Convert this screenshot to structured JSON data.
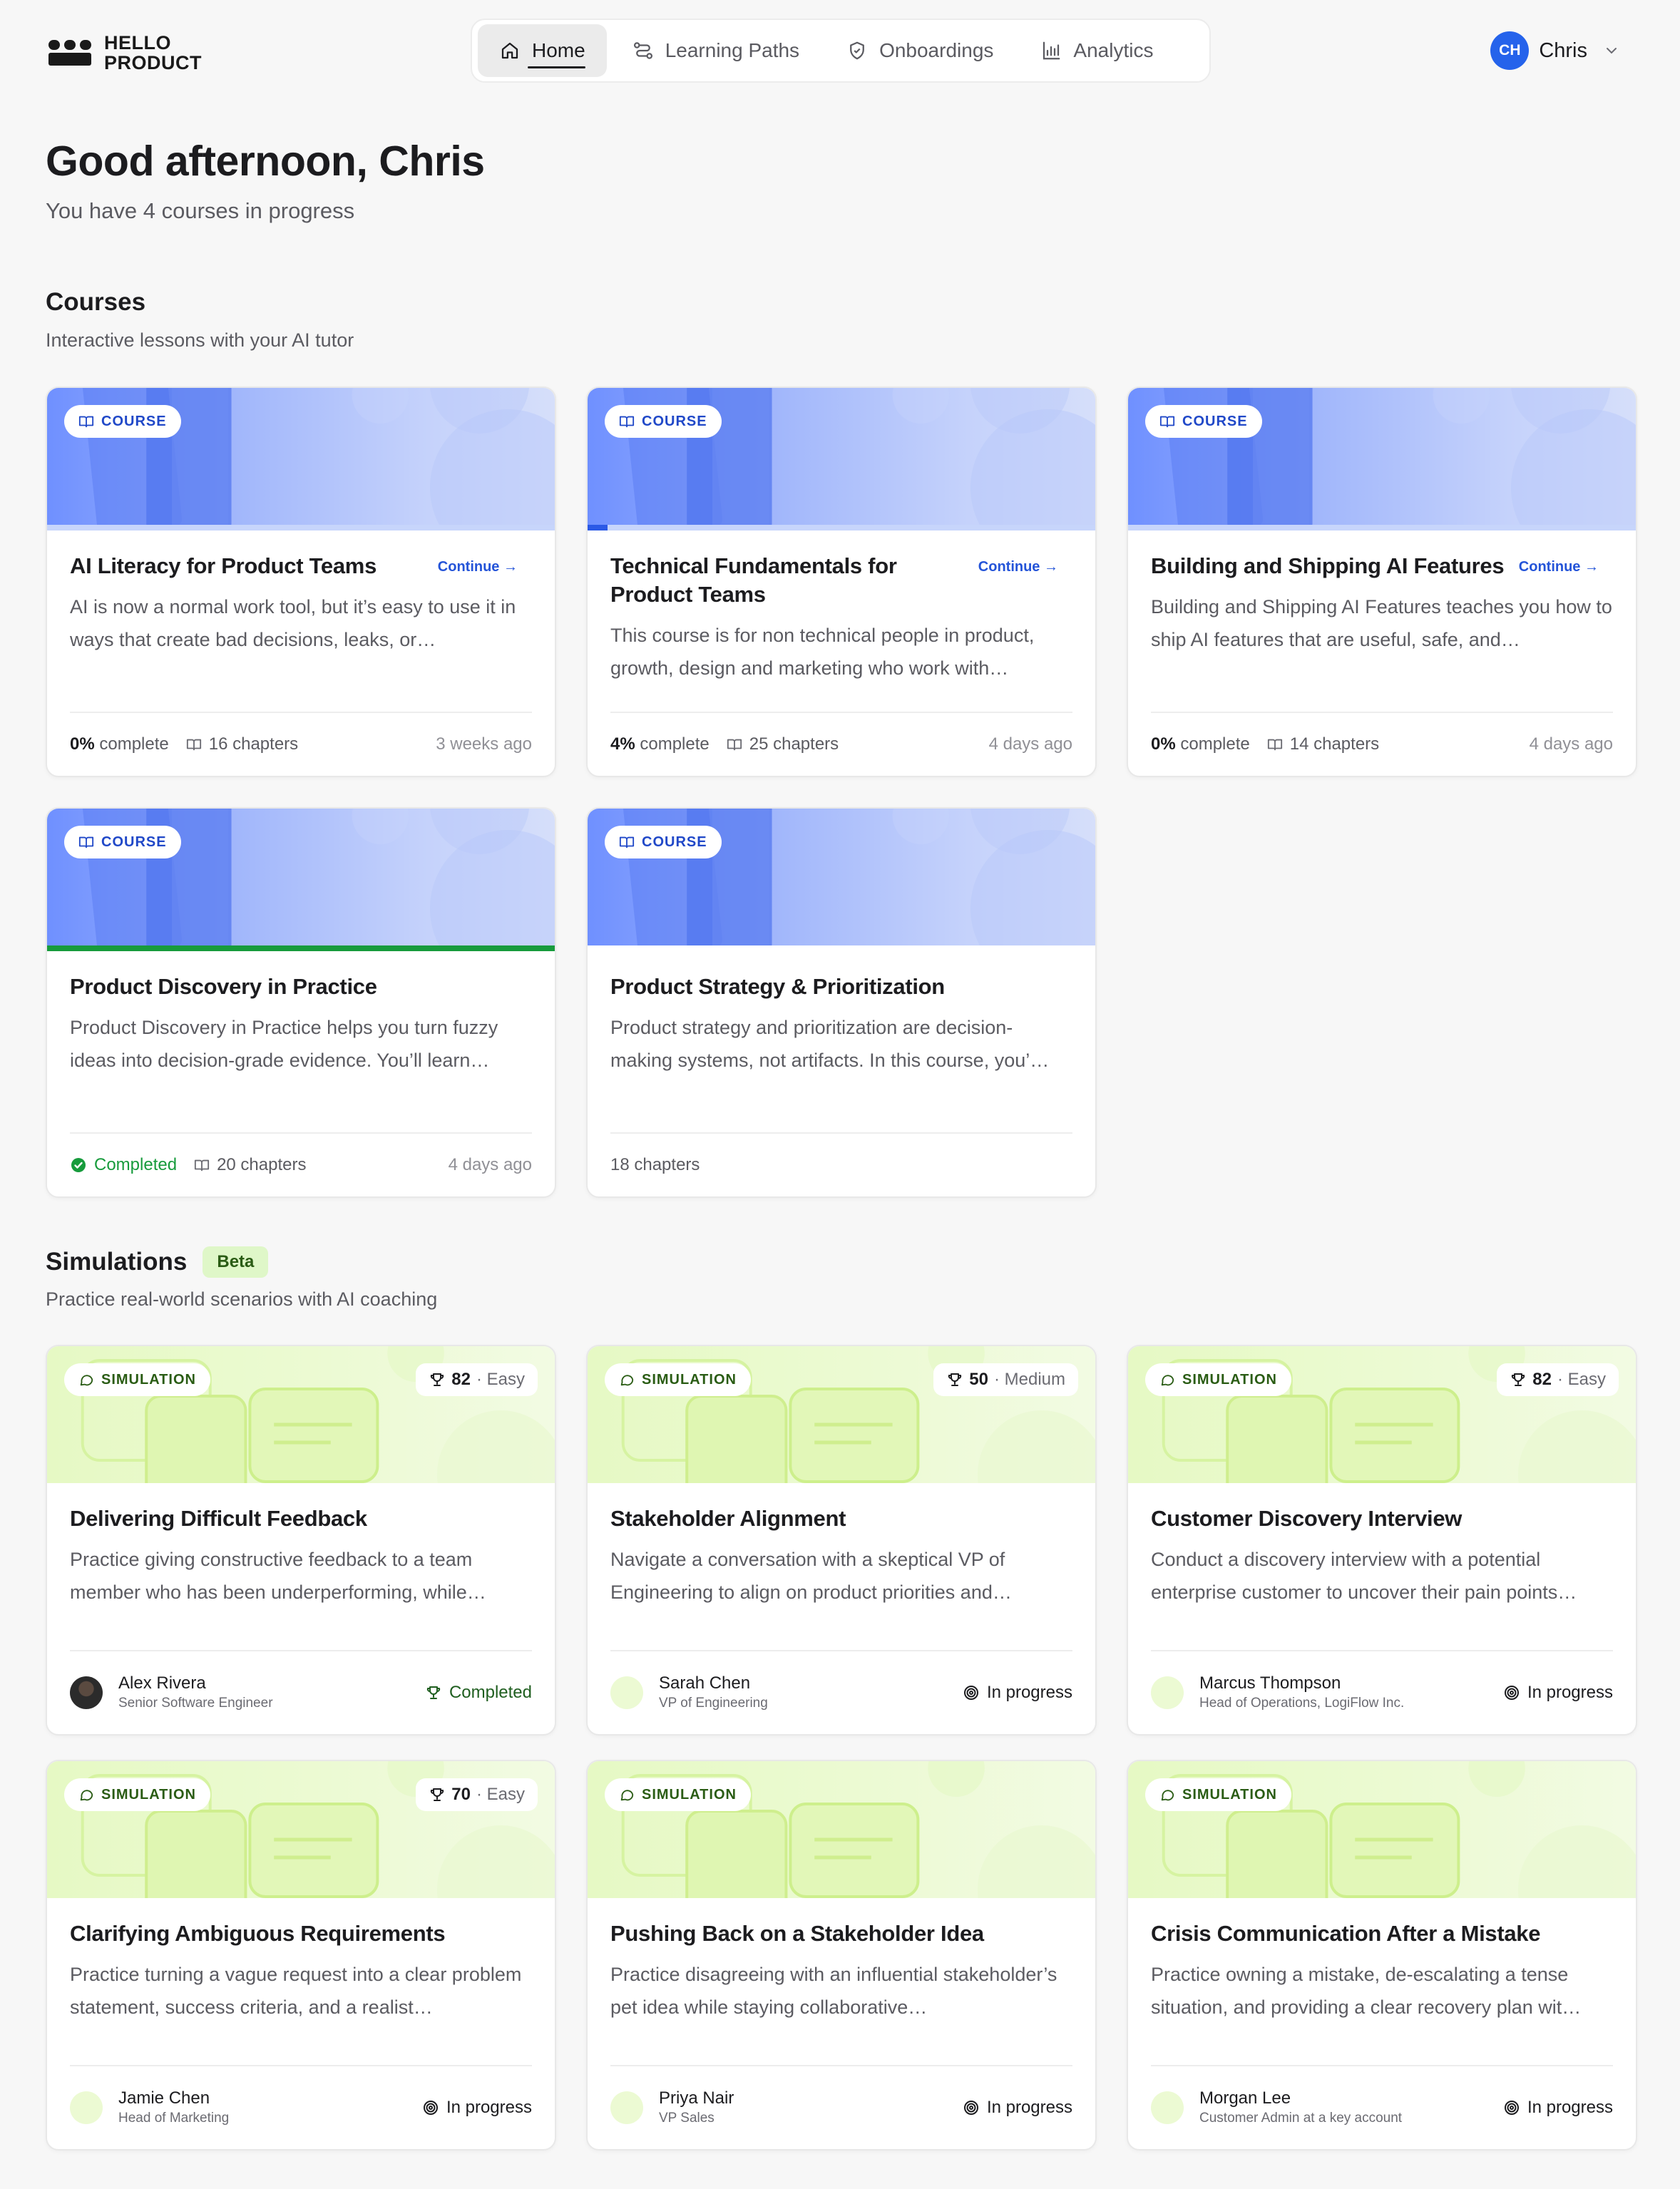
{
  "brand": {
    "line1": "HELLO",
    "line2": "PRODUCT"
  },
  "nav": [
    {
      "label": "Home",
      "icon": "home-icon",
      "active": true
    },
    {
      "label": "Learning Paths",
      "icon": "route-icon",
      "active": false
    },
    {
      "label": "Onboardings",
      "icon": "shield-icon",
      "active": false
    },
    {
      "label": "Analytics",
      "icon": "bar-chart-icon",
      "active": false
    }
  ],
  "user": {
    "initials": "CH",
    "name": "Chris"
  },
  "greeting": {
    "title": "Good afternoon, Chris",
    "subtitle": "You have 4 courses in progress"
  },
  "courses_section": {
    "title": "Courses",
    "subtitle": "Interactive lessons with your AI tutor"
  },
  "courses": [
    {
      "badge": "COURSE",
      "title": "AI Literacy for Product Teams",
      "action": "Continue →",
      "description": "AI is now a normal work tool, but it’s easy to use it in ways that create bad decisions, leaks, or…",
      "progress_pct": 0,
      "progress_label": "0%",
      "progress_suffix": "complete",
      "chapters": "16 chapters",
      "updated": "3 weeks ago"
    },
    {
      "badge": "COURSE",
      "title": "Technical Fundamentals for Product Teams",
      "action": "Continue →",
      "description": "This course is for non technical people in product, growth, design and marketing who work with…",
      "progress_pct": 4,
      "progress_label": "4%",
      "progress_suffix": "complete",
      "chapters": "25 chapters",
      "updated": "4 days ago"
    },
    {
      "badge": "COURSE",
      "title": "Building and Shipping AI Features",
      "action": "Continue →",
      "description": "Building and Shipping AI Features teaches you how to ship AI features that are useful, safe, and…",
      "progress_pct": 0,
      "progress_label": "0%",
      "progress_suffix": "complete",
      "chapters": "14 chapters",
      "updated": "4 days ago"
    },
    {
      "badge": "COURSE",
      "title": "Product Discovery in Practice",
      "description": "Product Discovery in Practice helps you turn fuzzy ideas into decision-grade evidence. You’ll learn…",
      "progress_pct": 100,
      "status": "Completed",
      "chapters": "20 chapters",
      "updated": "4 days ago"
    },
    {
      "badge": "COURSE",
      "title": "Product Strategy & Prioritization",
      "description": "Product strategy and prioritization are decision-making systems, not artifacts. In this course, you’…",
      "chapters": "18 chapters"
    }
  ],
  "simulations_section": {
    "title": "Simulations",
    "badge": "Beta",
    "subtitle": "Practice real-world scenarios with AI coaching"
  },
  "simulations": [
    {
      "badge": "SIMULATION",
      "score": "82",
      "difficulty": "· Easy",
      "title": "Delivering Difficult Feedback",
      "description": "Practice giving constructive feedback to a team member who has been underperforming, while…",
      "person": "Alex Rivera",
      "role": "Senior Software Engineer",
      "status": "Completed"
    },
    {
      "badge": "SIMULATION",
      "score": "50",
      "difficulty": "· Medium",
      "title": "Stakeholder Alignment",
      "description": "Navigate a conversation with a skeptical VP of Engineering to align on product priorities and…",
      "person": "Sarah Chen",
      "role": "VP of Engineering",
      "status": "In progress"
    },
    {
      "badge": "SIMULATION",
      "score": "82",
      "difficulty": "· Easy",
      "title": "Customer Discovery Interview",
      "description": "Conduct a discovery interview with a potential enterprise customer to uncover their pain points…",
      "person": "Marcus Thompson",
      "role": "Head of Operations, LogiFlow Inc.",
      "status": "In progress"
    },
    {
      "badge": "SIMULATION",
      "score": "70",
      "difficulty": "· Easy",
      "title": "Clarifying Ambiguous Requirements",
      "description": "Practice turning a vague request into a clear problem statement, success criteria, and a realist…",
      "person": "Jamie Chen",
      "role": "Head of Marketing",
      "status": "In progress"
    },
    {
      "badge": "SIMULATION",
      "title": "Pushing Back on a Stakeholder Idea",
      "description": "Practice disagreeing with an influential stakeholder’s pet idea while staying collaborative…",
      "person": "Priya Nair",
      "role": "VP Sales",
      "status": "In progress"
    },
    {
      "badge": "SIMULATION",
      "title": "Crisis Communication After a Mistake",
      "description": "Practice owning a mistake, de-escalating a tense situation, and providing a clear recovery plan wit…",
      "person": "Morgan Lee",
      "role": "Customer Admin at a key account",
      "status": "In progress"
    }
  ]
}
